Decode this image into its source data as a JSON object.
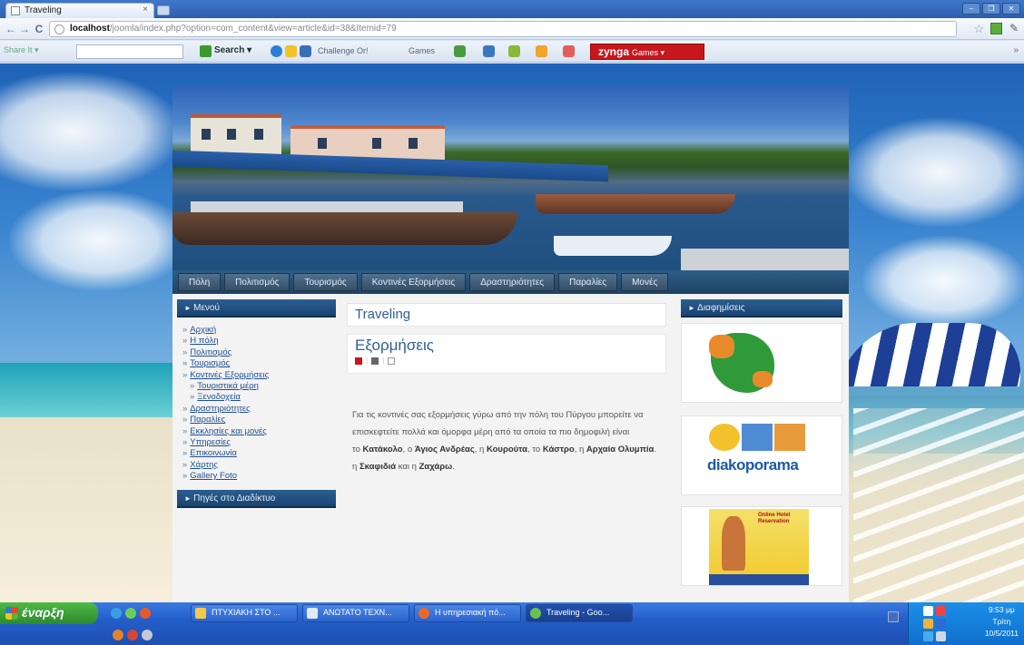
{
  "browser": {
    "tab_title": "Traveling",
    "tab_close": "×",
    "url_host": "localhost",
    "url_path": "/joomla/index.php?option=com_content&view=article&id=38&Itemid=79",
    "back": "←",
    "forward": "→",
    "reload": "C",
    "star": "☆",
    "wrench": "✎",
    "window_controls": [
      "–",
      "❐",
      "✕"
    ]
  },
  "toolbar": {
    "share": "Share It ▾",
    "search_label": "Search ▾",
    "challenge": "Challenge Or!",
    "games": "Games",
    "zynga": "zynga",
    "zynga_sub": "Games ▾",
    "end": "»"
  },
  "site": {
    "nav": [
      "Πόλη",
      "Πολιτισμός",
      "Τουρισμός",
      "Κοντινές Εξορμήσεις",
      "Δραστηριότητες",
      "Παραλίες",
      "Μονές"
    ],
    "left_menu_title": "Μενού",
    "menu": [
      {
        "label": "Αρχική",
        "sub": false
      },
      {
        "label": "Η πόλη",
        "sub": false
      },
      {
        "label": "Πολιτισμός",
        "sub": false
      },
      {
        "label": "Τουρισμός",
        "sub": false
      },
      {
        "label": "Κοντινές Εξορμήσεις",
        "sub": false
      },
      {
        "label": "Τουριστικά μέρη",
        "sub": true
      },
      {
        "label": "Ξενοδοχεία",
        "sub": true
      },
      {
        "label": "Δραστηριότητες",
        "sub": false
      },
      {
        "label": "Παραλίες",
        "sub": false
      },
      {
        "label": "Εκκλησίες και μονές",
        "sub": false
      },
      {
        "label": "Υπηρεσίες",
        "sub": false
      },
      {
        "label": "Επικοινωνία",
        "sub": false
      },
      {
        "label": "Χάρτης",
        "sub": false
      },
      {
        "label": "Gallery Foto",
        "sub": false
      }
    ],
    "left_module2_title": "Πηγές στο Διαδίκτυο",
    "page_heading": "Traveling",
    "article_title": "Εξορμήσεις",
    "article": {
      "p1": "Για τις κοντινές σας εξορμήσεις γύρω από την πόλη του Πύργου μπορείτε να",
      "p2": "επισκεφτείτε πολλά και όμορφα μέρη από τα οποία τα πιο δημοφιλή είναι",
      "p3_intro": "το ",
      "p3_places": [
        {
          "pre": "",
          "name": "Κατάκολο",
          "post": ", ο "
        },
        {
          "pre": "",
          "name": "Άγιος Ανδρέας",
          "post": ", η "
        },
        {
          "pre": "",
          "name": "Κουρούτα",
          "post": ", το "
        },
        {
          "pre": "",
          "name": "Κάστρο",
          "post": ", η "
        },
        {
          "pre": "",
          "name": "Αρχαία Ολυμπία",
          "post": "."
        }
      ],
      "p4_a": "η ",
      "p4_b": "Σκαφιδιά",
      "p4_c": " και η ",
      "p4_d": "Ζαχάρω",
      "p4_e": "."
    },
    "right_title": "Διαφημίσεις",
    "ad2_text": "diakoporama",
    "ad3_text": "Online Hotel Reservation"
  },
  "taskbar": {
    "start": "έναρξη",
    "tasks": [
      "ΠΤΥΧΙΑΚΗ ΣΤΟ ...",
      "ΑΝΩΤΑΤΟ ΤΕΧΝ...",
      "Η υπηρεσιακή πό...",
      "Traveling - Goo..."
    ],
    "time": "9:53 μμ",
    "day": "Τρίτη",
    "date": "10/5/2011"
  },
  "colors": {
    "nav_bg": "#1d4466",
    "module_head": "#1a4472",
    "link": "#1c4f96",
    "heading": "#2c5e9a",
    "zynga_red": "#c8161d"
  }
}
